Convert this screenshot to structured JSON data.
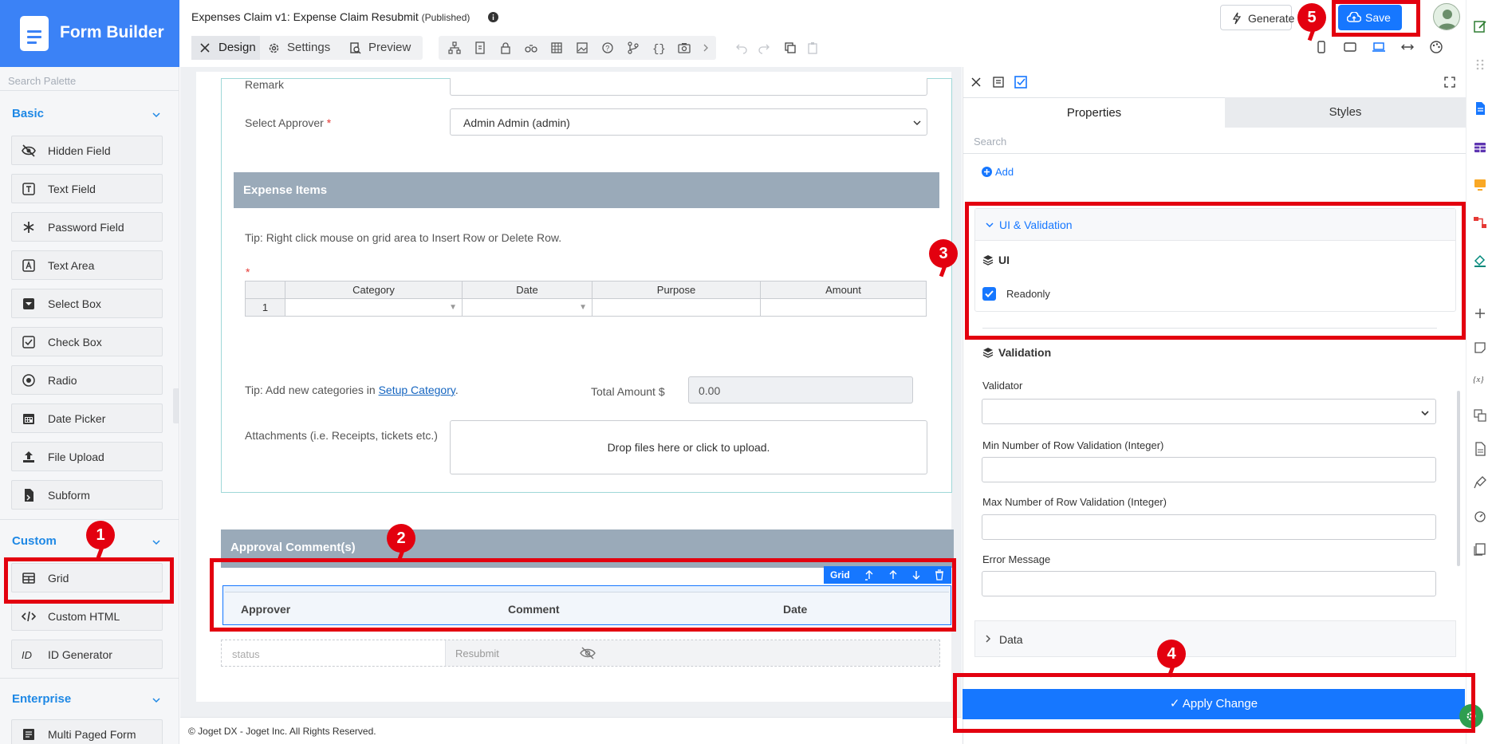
{
  "app": {
    "name": "Form Builder"
  },
  "palette": {
    "search_placeholder": "Search Palette",
    "basic_header": "Basic",
    "custom_header": "Custom",
    "enterprise_header": "Enterprise",
    "basic_items": [
      "Hidden Field",
      "Text Field",
      "Password Field",
      "Text Area",
      "Select Box",
      "Check Box",
      "Radio",
      "Date Picker",
      "File Upload",
      "Subform"
    ],
    "custom_items": [
      "Grid",
      "Custom HTML",
      "ID Generator"
    ],
    "enterprise_items": [
      "Multi Paged Form"
    ]
  },
  "header": {
    "form_title": "Expenses Claim v1: Expense Claim Resubmit",
    "published": "(Published)",
    "tabs": [
      "Design",
      "Settings",
      "Preview"
    ],
    "generate_label": "Generate",
    "save_label": "Save"
  },
  "form": {
    "remark_label": "Remark",
    "approver_label": "Select Approver",
    "approver_required": "*",
    "approver_value": "Admin Admin (admin)",
    "expense_items_header": "Expense Items",
    "grid_tip": "Tip: Right click mouse on grid area to Insert Row or Delete Row.",
    "grid_required": "*",
    "grid_columns": [
      "Category",
      "Date",
      "Purpose",
      "Amount"
    ],
    "grid_row_number": "1",
    "category_tip_prefix": "Tip: Add new categories in ",
    "category_tip_link": "Setup Category",
    "category_tip_suffix": ".",
    "total_label": "Total Amount $",
    "total_value": "0.00",
    "attachments_label": "Attachments (i.e. Receipts, tickets etc.)",
    "drop_text": "Drop files here or click to upload.",
    "approval_header": "Approval Comment(s)",
    "selected_element_tag": "Grid",
    "approval_columns": [
      "Approver",
      "Comment",
      "Date"
    ],
    "status_label": "status",
    "status_value": "Resubmit"
  },
  "footer": {
    "copyright": "© Joget DX - Joget Inc. All Rights Reserved."
  },
  "panel": {
    "tabs": [
      "Properties",
      "Styles"
    ],
    "search_placeholder": "Search",
    "add_label": "Add",
    "ui_validation_header": "UI & Validation",
    "ui_subheader": "UI",
    "readonly_label": "Readonly",
    "readonly_checked": true,
    "validation_subheader": "Validation",
    "validator_label": "Validator",
    "min_rows_label": "Min Number of Row Validation (Integer)",
    "max_rows_label": "Max Number of Row Validation (Integer)",
    "error_label": "Error Message",
    "data_header": "Data",
    "apply_label": "Apply Change"
  },
  "annotations": [
    "1",
    "2",
    "3",
    "4",
    "5"
  ],
  "colors": {
    "brand": "#3b82f6",
    "primary": "#1677ff",
    "annotation": "#e3000f",
    "section_header": "#9aaab9"
  }
}
